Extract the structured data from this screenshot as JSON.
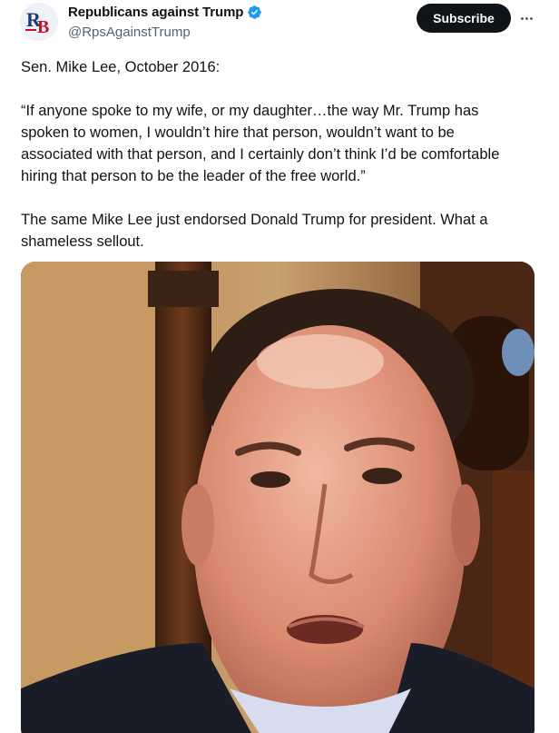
{
  "author": {
    "display_name": "Republicans against Trump",
    "handle": "@RpsAgainstTrump",
    "avatar_text": "RB"
  },
  "actions": {
    "subscribe_label": "Subscribe",
    "more_icon": "more-horizontal-icon"
  },
  "tweet": {
    "lines": [
      "Sen. Mike Lee, October 2016:",
      "“If anyone spoke to my wife, or my daughter…the way Mr. Trump has spoken to women, I wouldn’t hire that person, wouldn’t want to be associated with that person, and I certainly don’t think I’d be comfortable hiring that person to be the leader of the free world.”",
      "The same Mike Lee just endorsed Donald Trump for president. What a shameless sellout."
    ]
  },
  "colors": {
    "text": "#0f1419",
    "secondary": "#536471",
    "verified": "#1d9bf0",
    "button_bg": "#0f1419"
  }
}
